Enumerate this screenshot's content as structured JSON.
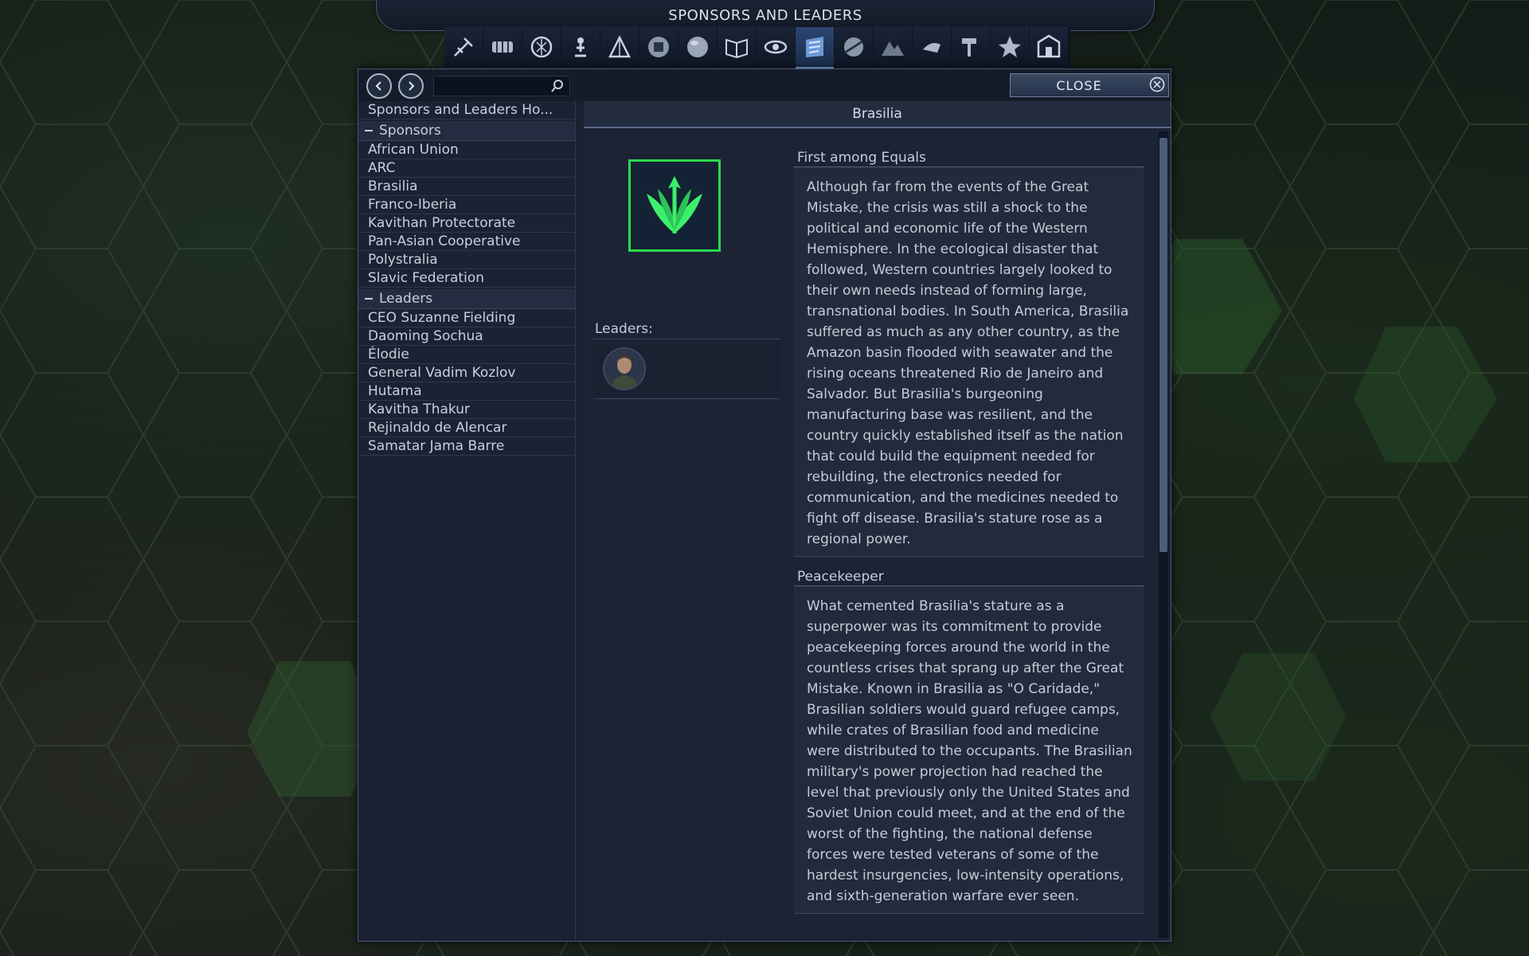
{
  "header": {
    "title": "SPONSORS AND LEADERS"
  },
  "category_tabs": [
    {
      "icon": "home-tech-icon",
      "active": false
    },
    {
      "icon": "crates-icon",
      "active": false
    },
    {
      "icon": "circuit-globe-icon",
      "active": false
    },
    {
      "icon": "person-unit-icon",
      "active": false
    },
    {
      "icon": "tent-icon",
      "active": false
    },
    {
      "icon": "disc-icon",
      "active": false
    },
    {
      "icon": "sphere-icon",
      "active": false
    },
    {
      "icon": "open-book-icon",
      "active": false
    },
    {
      "icon": "eye-icon",
      "active": false
    },
    {
      "icon": "sponsor-globe-icon",
      "active": true
    },
    {
      "icon": "planet-icon",
      "active": false
    },
    {
      "icon": "mountain-icon",
      "active": false
    },
    {
      "icon": "satellite-icon",
      "active": false
    },
    {
      "icon": "hammer-icon",
      "active": false
    },
    {
      "icon": "star-icon",
      "active": false
    },
    {
      "icon": "building-icon",
      "active": false
    }
  ],
  "toolbar": {
    "search_placeholder": "",
    "close_label": "CLOSE"
  },
  "sidebar": {
    "home_label": "Sponsors and Leaders Ho...",
    "sponsors_header": "Sponsors",
    "sponsors": [
      "African Union",
      "ARC",
      "Brasilia",
      "Franco-Iberia",
      "Kavithan Protectorate",
      "Pan-Asian Cooperative",
      "Polystralia",
      "Slavic Federation"
    ],
    "leaders_header": "Leaders",
    "leaders": [
      "CEO Suzanne Fielding",
      "Daoming Sochua",
      "Élodie",
      "General Vadim Kozlov",
      "Hutama",
      "Kavitha Thakur",
      "Rejinaldo de Alencar",
      "Samatar Jama Barre"
    ]
  },
  "content": {
    "title": "Brasilia",
    "leaders_label": "Leaders:",
    "sections": [
      {
        "title": "First among Equals",
        "body": "Although far from the events of the Great Mistake, the crisis was still a shock to the political and economic life of the Western Hemisphere. In the ecological disaster that followed, Western countries largely looked to their own needs instead of forming large, transnational bodies. In South America, Brasilia suffered as much as any other country, as the Amazon basin flooded with seawater and the rising oceans threatened Rio de Janeiro and Salvador. But Brasilia's burgeoning manufacturing base was resilient, and the country quickly established itself as the nation that could build the equipment needed for rebuilding, the electronics needed for communication, and the medicines needed to fight off disease. Brasilia's stature rose as a regional power."
      },
      {
        "title": "Peacekeeper",
        "body": "What cemented Brasilia's stature as a superpower was its commitment to provide peacekeeping forces around the world in the countless crises that sprang up after the Great Mistake. Known in Brasilia as \"O Caridade,\" Brasilian soldiers would guard refugee camps, while crates of Brasilian food and medicine were distributed to the occupants. The Brasilian military's power projection had reached the level that previously only the United States and Soviet Union could meet, and at the end of the worst of the fighting, the national defense forces were tested veterans of some of the hardest insurgencies, low-intensity operations, and sixth-generation warfare ever seen."
      }
    ]
  },
  "colors": {
    "emblem_border": "#2adb4b",
    "emblem_glyph": "#3cf06a",
    "active_tab": "#2c4670"
  }
}
